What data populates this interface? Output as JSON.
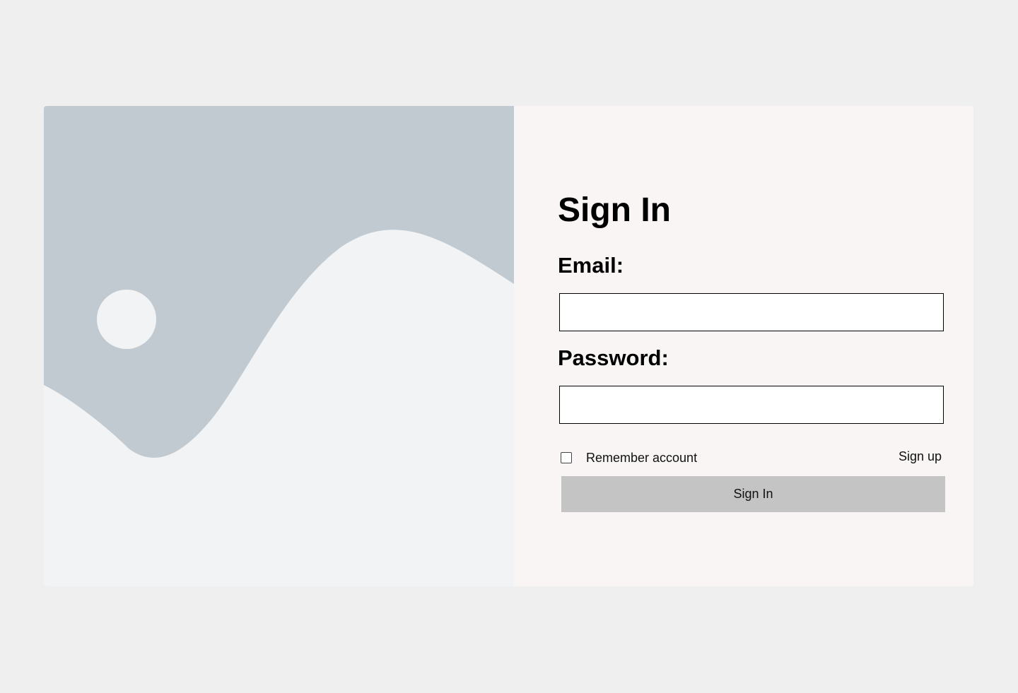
{
  "colors": {
    "page_background": "#efefef",
    "illustration_sky": "#c2cad1",
    "illustration_foreground": "#f2f3f5",
    "form_background": "#f8f5f4",
    "button_background": "#c4c4c4"
  },
  "illustration": {
    "icon": "image-placeholder-icon"
  },
  "form": {
    "title": "Sign In",
    "email_label": "Email:",
    "email_value": "",
    "password_label": "Password:",
    "password_value": "",
    "remember_label": "Remember account",
    "remember_checked": false,
    "signup_label": "Sign up",
    "submit_label": "Sign In"
  }
}
